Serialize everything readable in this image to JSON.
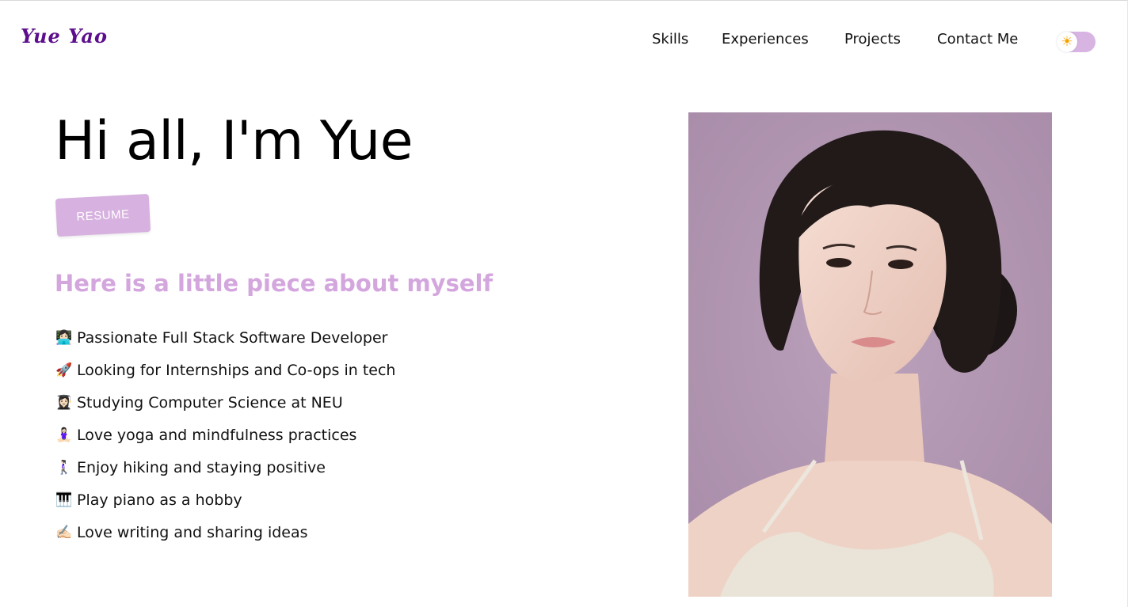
{
  "header": {
    "logo_text": "Yue Yao",
    "nav": [
      {
        "label": "Skills"
      },
      {
        "label": "Experiences"
      },
      {
        "label": "Projects"
      },
      {
        "label": "Contact Me"
      }
    ],
    "theme_toggle": {
      "icon": "sun-icon",
      "glyph": "☀",
      "state": "light"
    }
  },
  "hero": {
    "greeting": "Hi all, I'm Yue",
    "resume_label": "RESUME",
    "subtitle": "Here is a little piece about myself",
    "facts": [
      {
        "emoji": "👩🏻‍💻",
        "text": "Passionate Full Stack Software Developer"
      },
      {
        "emoji": "🚀",
        "text": "Looking for Internships and Co-ops in tech"
      },
      {
        "emoji": "👩🏻‍🎓",
        "text": "Studying Computer Science at NEU"
      },
      {
        "emoji": "🧘🏻‍♀️",
        "text": "Love yoga and mindfulness practices"
      },
      {
        "emoji": "🚶🏻‍♀️",
        "text": "Enjoy hiking and staying positive"
      },
      {
        "emoji": "🎹",
        "text": "Play piano as a hobby"
      },
      {
        "emoji": "✍🏻",
        "text": "Love writing and sharing ideas"
      }
    ],
    "portrait": {
      "icon": "portrait-photo"
    }
  },
  "colors": {
    "accent": "#d7b1df",
    "subtitle": "#d4a6de",
    "logo": "#5c0e8c",
    "portrait_bg": "#b095b0"
  }
}
